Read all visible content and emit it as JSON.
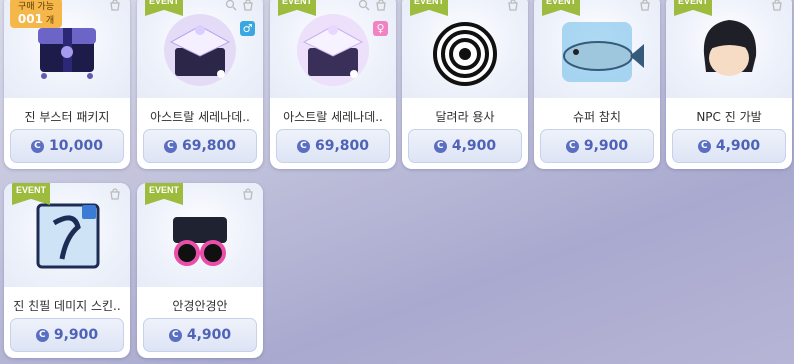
{
  "colors": {
    "accent": "#4e63b8",
    "event": "#9dbb3c",
    "male": "#3aa7e0",
    "female": "#f083c2",
    "limit": "#f6b74a"
  },
  "items": [
    {
      "name": "진 부스터 패키지",
      "price": "10,000",
      "event": false,
      "limit": {
        "label": "구매 가능",
        "count": "001",
        "unit": "개"
      },
      "icon": "treasure-box-icon"
    },
    {
      "name": "아스트랄 세레나데..",
      "price": "69,800",
      "event": true,
      "gender": "♂",
      "icon": "astral-box-icon"
    },
    {
      "name": "아스트랄 세레나데..",
      "price": "69,800",
      "event": true,
      "gender": "♀",
      "icon": "astral-box-icon"
    },
    {
      "name": "달려라 용사",
      "price": "4,900",
      "event": true,
      "icon": "spiral-icon"
    },
    {
      "name": "슈퍼 참치",
      "price": "9,900",
      "event": true,
      "icon": "tuna-icon"
    },
    {
      "name": "NPC 진 가발",
      "price": "4,900",
      "event": true,
      "icon": "wig-icon"
    },
    {
      "name": "진 친필 데미지 스킨..",
      "price": "9,900",
      "event": true,
      "icon": "damage-skin-icon"
    },
    {
      "name": "안경안경안",
      "price": "4,900",
      "event": true,
      "icon": "glasses-icon"
    }
  ],
  "event_label": "EVENT",
  "coin_symbol": "C"
}
